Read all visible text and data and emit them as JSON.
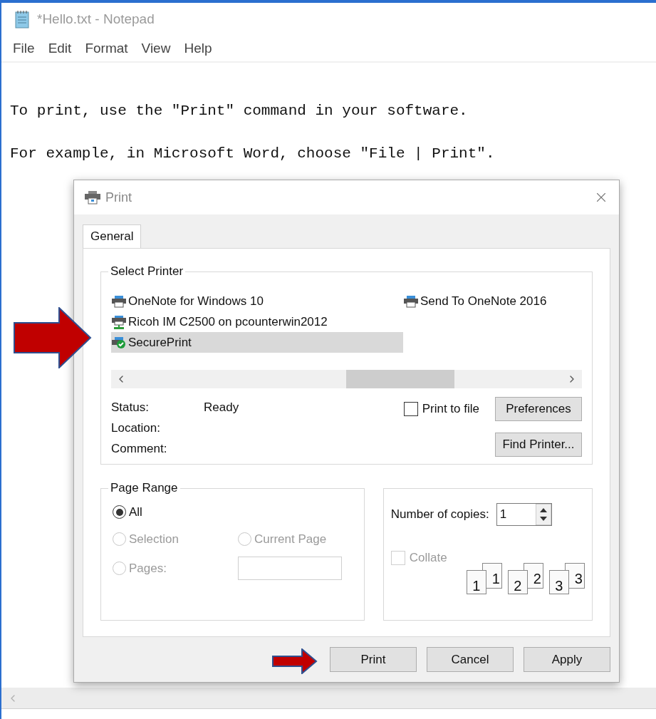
{
  "window": {
    "title": "*Hello.txt - Notepad"
  },
  "menu": [
    "File",
    "Edit",
    "Format",
    "View",
    "Help"
  ],
  "document": {
    "lines": [
      "To print, use the \"Print\" command in your software.",
      "For example, in Microsoft Word, choose \"File | Print\"."
    ]
  },
  "dialog": {
    "title": "Print",
    "tabs": [
      {
        "label": "General",
        "selected": true
      }
    ],
    "select_printer": {
      "title": "Select Printer",
      "columns": [
        [
          {
            "name": "OneNote for Windows 10",
            "kind": "printer",
            "selected": false
          },
          {
            "name": "Ricoh IM C2500 on pcounterwin2012",
            "kind": "network",
            "selected": false
          },
          {
            "name": "SecurePrint",
            "kind": "default",
            "selected": true
          }
        ],
        [
          {
            "name": "Send To OneNote 2016",
            "kind": "printer",
            "selected": false
          }
        ]
      ],
      "info": [
        {
          "label": "Status:",
          "value": "Ready"
        },
        {
          "label": "Location:"
        },
        {
          "label": "Comment:"
        }
      ],
      "print_to_file": {
        "label": "Print to file",
        "checked": false
      },
      "buttons": [
        "Preferences",
        "Find Printer..."
      ]
    },
    "page_range": {
      "title": "Page Range",
      "rows": [
        [
          {
            "label": "All",
            "selected": true,
            "disabled": false,
            "kind": "plain"
          }
        ],
        [
          {
            "label": "Selection",
            "selected": false,
            "disabled": true,
            "kind": "plain"
          },
          {
            "label": "Current Page",
            "selected": false,
            "disabled": true,
            "kind": "plain"
          }
        ],
        [
          {
            "label": "Pages:",
            "selected": false,
            "disabled": true,
            "kind": "with_field"
          }
        ]
      ]
    },
    "copies": {
      "label": "Number of copies:",
      "value": "1",
      "collate": {
        "label": "Collate",
        "checked": false,
        "disabled": true
      },
      "pages": [
        {
          "front": "1",
          "back": "1"
        },
        {
          "front": "2",
          "back": "2"
        },
        {
          "front": "3",
          "back": "3"
        }
      ]
    },
    "buttons": [
      "Print",
      "Cancel",
      "Apply"
    ]
  }
}
